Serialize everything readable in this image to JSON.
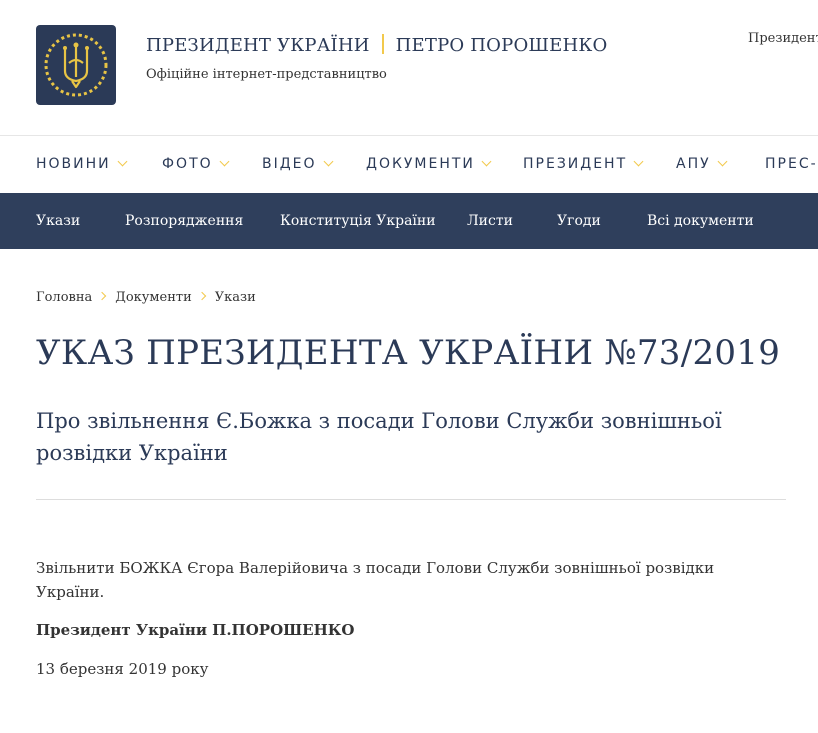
{
  "header": {
    "title_left": "ПРЕЗИДЕНТ УКРАЇНИ",
    "title_right": "ПЕТРО ПОРОШЕНКО",
    "subtitle": "Офіційне інтернет-представництво",
    "top_right": "Президент",
    "logo_icon": "trident-emblem-icon"
  },
  "nav": {
    "items": [
      {
        "label": "НОВИНИ"
      },
      {
        "label": "ФОТО"
      },
      {
        "label": "ВІДЕО"
      },
      {
        "label": "ДОКУМЕНТИ"
      },
      {
        "label": "ПРЕЗИДЕНТ"
      },
      {
        "label": "АПУ"
      },
      {
        "label": "ПРЕС-Ц"
      }
    ]
  },
  "subnav": {
    "items": [
      {
        "label": "Укази"
      },
      {
        "label": "Розпорядження"
      },
      {
        "label": "Конституція України"
      },
      {
        "label": "Листи"
      },
      {
        "label": "Угоди"
      },
      {
        "label": "Всі документи"
      }
    ]
  },
  "breadcrumb": [
    "Головна",
    "Документи",
    "Укази"
  ],
  "document": {
    "title": "УКАЗ ПРЕЗИДЕНТА УКРАЇНИ №73/2019",
    "subtitle": "Про звільнення Є.Божка з посади Голови Служби зовнішньої розвідки України",
    "body": "Звільнити БОЖКА Єгора Валерійовича з посади Голови Служби зовнішньої розвідки України.",
    "signature": "Президент України П.ПОРОШЕНКО",
    "date": "13 березня 2019 року"
  },
  "colors": {
    "brand_navy": "#2b3a57",
    "subnav_bg": "#2f3f5c",
    "accent_gold": "#f2c94c"
  }
}
